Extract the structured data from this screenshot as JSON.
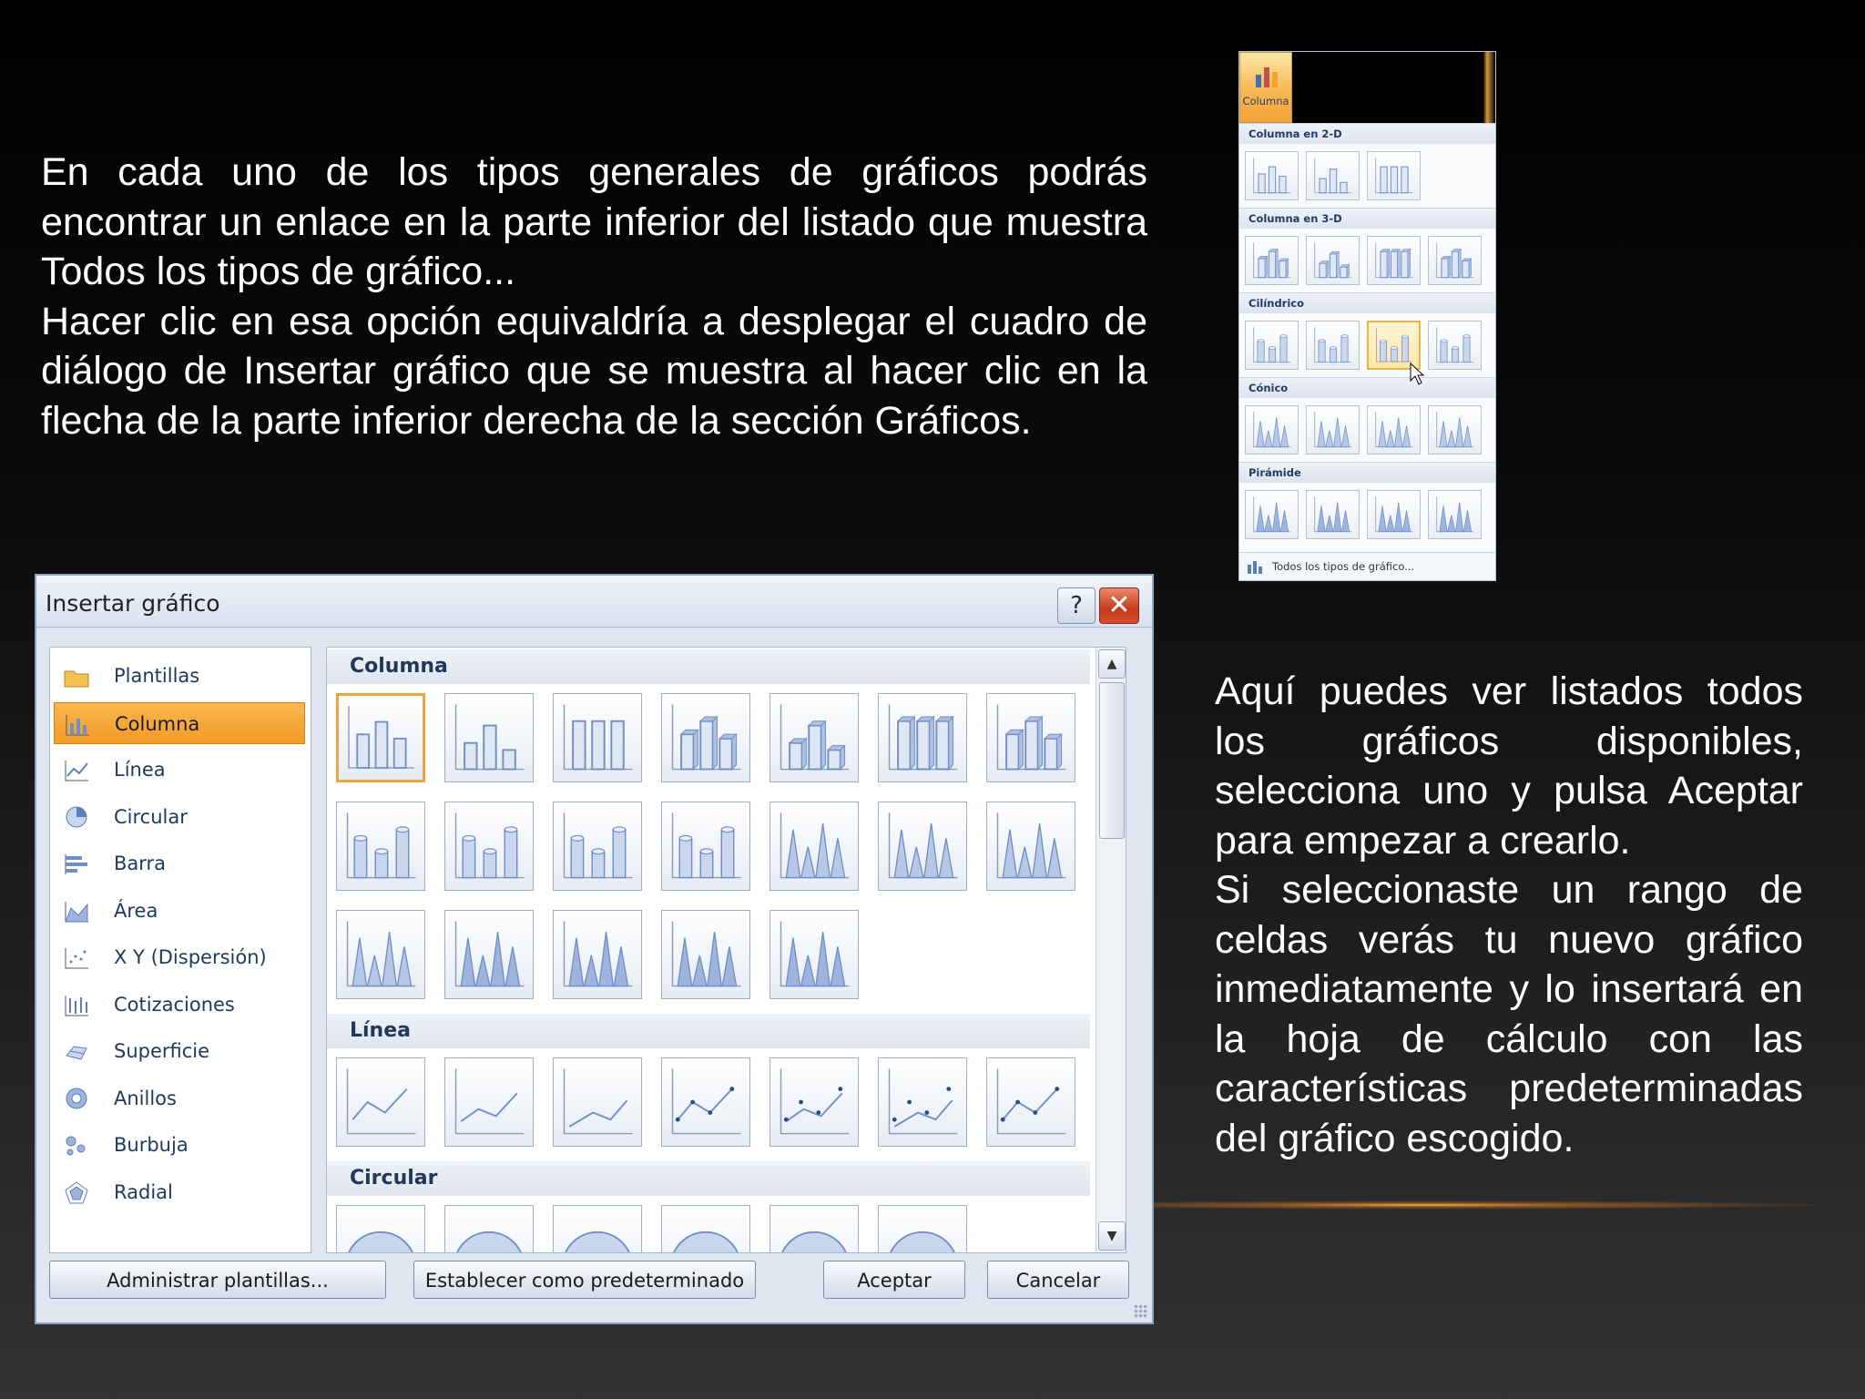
{
  "slide": {
    "text_top": [
      "En cada uno de los tipos generales de gráficos podrás encontrar un enlace en la parte inferior del listado que muestra Todos los tipos de gráfico...",
      "Hacer clic en esa opción equivaldría a desplegar el cuadro de diálogo de Insertar gráfico que se muestra al hacer clic en la flecha de la parte inferior derecha de la sección Gráficos."
    ],
    "text_right": [
      "Aquí puedes ver listados todos los gráficos disponibles, selecciona uno y pulsa Aceptar para empezar a crearlo.",
      "Si seleccionaste un rango de celdas verás tu nuevo gráfico inmediatamente y lo insertará en la hoja de cálculo con las características predeterminadas del gráfico escogido."
    ]
  },
  "ribbon": {
    "button_label": "Columna",
    "sections": [
      {
        "label": "Columna en 2-D",
        "count": 3
      },
      {
        "label": "Columna en 3-D",
        "count": 4
      },
      {
        "label": "Cilíndrico",
        "count": 4,
        "selected": 2
      },
      {
        "label": "Cónico",
        "count": 4
      },
      {
        "label": "Pirámide",
        "count": 4
      }
    ],
    "footer_label": "Todos los tipos de gráfico..."
  },
  "dialog": {
    "title": "Insertar gráfico",
    "help_label": "?",
    "close_label": "✕",
    "categories": [
      {
        "label": "Plantillas",
        "icon": "folder-icon"
      },
      {
        "label": "Columna",
        "icon": "column-chart-icon",
        "active": true
      },
      {
        "label": "Línea",
        "icon": "line-chart-icon"
      },
      {
        "label": "Circular",
        "icon": "pie-chart-icon"
      },
      {
        "label": "Barra",
        "icon": "bar-chart-icon"
      },
      {
        "label": "Área",
        "icon": "area-chart-icon"
      },
      {
        "label": "X Y (Dispersión)",
        "icon": "scatter-chart-icon"
      },
      {
        "label": "Cotizaciones",
        "icon": "stock-chart-icon"
      },
      {
        "label": "Superficie",
        "icon": "surface-chart-icon"
      },
      {
        "label": "Anillos",
        "icon": "doughnut-chart-icon"
      },
      {
        "label": "Burbuja",
        "icon": "bubble-chart-icon"
      },
      {
        "label": "Radial",
        "icon": "radar-chart-icon"
      }
    ],
    "groups": [
      {
        "label": "Columna",
        "count": 19,
        "selected": 0
      },
      {
        "label": "Línea",
        "count": 7
      },
      {
        "label": "Circular",
        "count": 6
      }
    ],
    "buttons": {
      "manage": "Administrar plantillas...",
      "default": "Establecer como predeterminado",
      "ok": "Aceptar",
      "cancel": "Cancelar"
    },
    "colors": {
      "accent": "#f39b26",
      "bar": "#6f8fc7"
    }
  }
}
